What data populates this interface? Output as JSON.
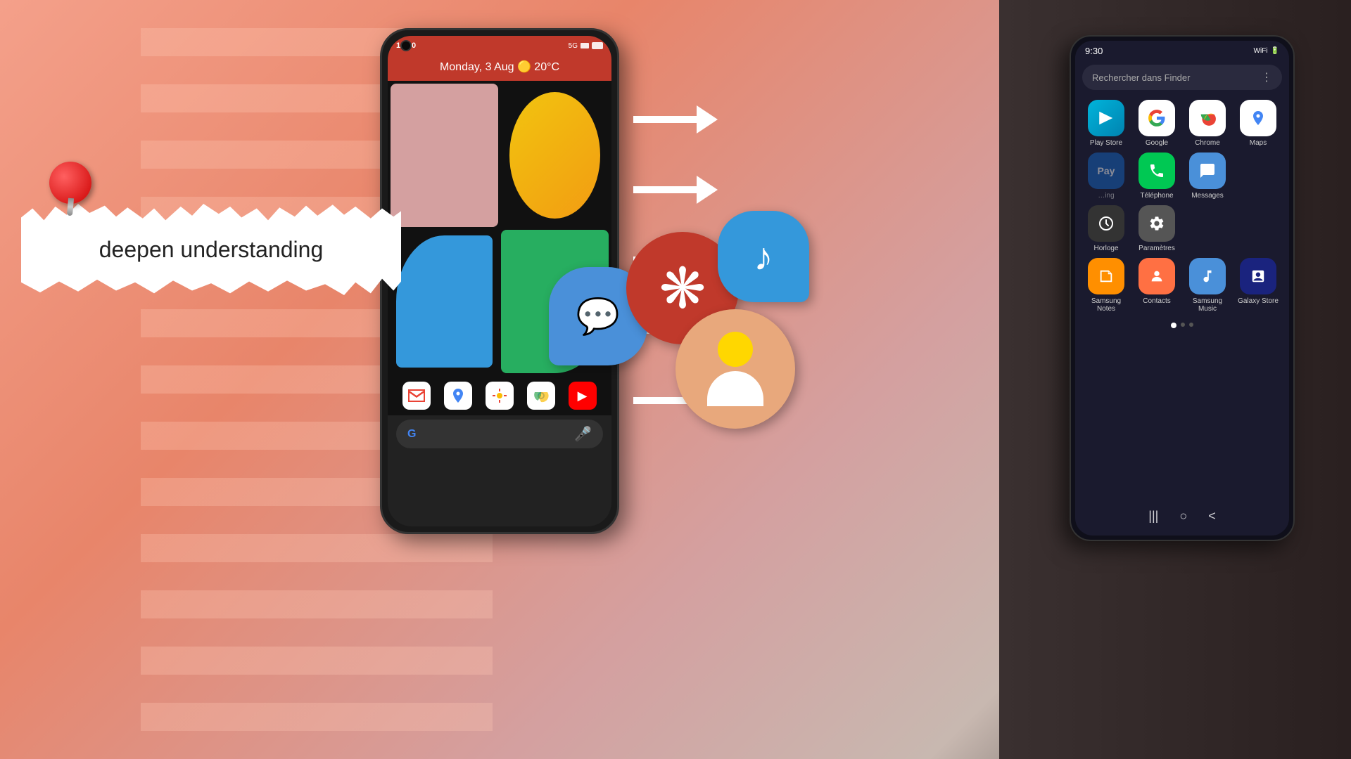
{
  "background": {
    "gradient": "salmon to dark"
  },
  "note": {
    "text": "deepen understanding"
  },
  "pixel_phone": {
    "time": "10:00",
    "date_weather": "Monday, 3 Aug 🟡 20°C",
    "dock_icons": [
      "✉",
      "📍",
      "🖼",
      "⊙",
      "▶"
    ],
    "search_placeholder": "G"
  },
  "arrows": {
    "count": 5,
    "direction": "right"
  },
  "samsung_phone": {
    "time": "9:30",
    "search_placeholder": "Rechercher dans Finder",
    "apps": [
      {
        "label": "Play Store",
        "color": "playstore",
        "icon": "▶"
      },
      {
        "label": "Google",
        "color": "google",
        "icon": "G"
      },
      {
        "label": "Chrome",
        "color": "chrome",
        "icon": "⊙"
      },
      {
        "label": "Maps",
        "color": "maps",
        "icon": "📍"
      },
      {
        "label": "Téléphone",
        "color": "phone",
        "icon": "📞"
      },
      {
        "label": "Messages",
        "color": "messages",
        "icon": "💬"
      },
      {
        "label": "Horloge",
        "color": "horloge",
        "icon": "🕐"
      },
      {
        "label": "Paramètres",
        "color": "params",
        "icon": "⚙"
      },
      {
        "label": "Samsung Notes",
        "color": "notes",
        "icon": "📝"
      },
      {
        "label": "Contacts",
        "color": "contacts",
        "icon": "👤"
      },
      {
        "label": "Samsung Music",
        "color": "music",
        "icon": "🎵"
      },
      {
        "label": "Galaxy Store",
        "color": "galaxy",
        "icon": "🛍"
      }
    ],
    "nav_items": [
      "|||",
      "○",
      "<"
    ]
  },
  "floating_apps": [
    {
      "name": "Messages",
      "type": "messages"
    },
    {
      "name": "Daisy",
      "type": "daisy"
    },
    {
      "name": "Music",
      "type": "music"
    },
    {
      "name": "Contact",
      "type": "contact"
    }
  ]
}
